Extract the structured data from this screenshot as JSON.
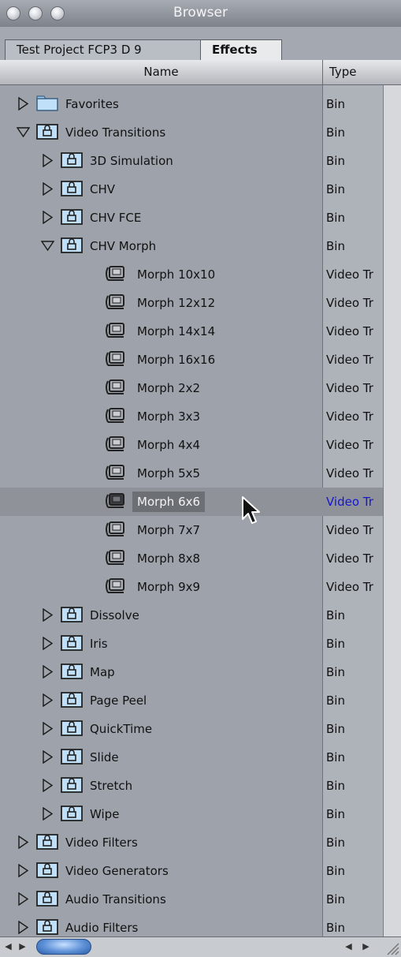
{
  "window": {
    "title": "Browser"
  },
  "tabs": [
    {
      "label": "Test Project FCP3 D 9",
      "active": false
    },
    {
      "label": "Effects",
      "active": true
    }
  ],
  "columns": {
    "name": "Name",
    "type": "Type"
  },
  "rows": [
    {
      "label": "Favorites",
      "type": "Bin",
      "level": 0,
      "expanded": false,
      "icon": "folder-icon"
    },
    {
      "label": "Video Transitions",
      "type": "Bin",
      "level": 0,
      "expanded": true,
      "icon": "locked-bin-icon"
    },
    {
      "label": "3D Simulation",
      "type": "Bin",
      "level": 1,
      "expanded": false,
      "icon": "locked-bin-icon"
    },
    {
      "label": "CHV",
      "type": "Bin",
      "level": 1,
      "expanded": false,
      "icon": "locked-bin-icon"
    },
    {
      "label": "CHV FCE",
      "type": "Bin",
      "level": 1,
      "expanded": false,
      "icon": "locked-bin-icon"
    },
    {
      "label": "CHV Morph",
      "type": "Bin",
      "level": 1,
      "expanded": true,
      "icon": "locked-bin-icon"
    },
    {
      "label": "Morph 10x10",
      "type": "Video Tr",
      "level": 2,
      "icon": "transition-icon"
    },
    {
      "label": "Morph 12x12",
      "type": "Video Tr",
      "level": 2,
      "icon": "transition-icon"
    },
    {
      "label": "Morph 14x14",
      "type": "Video Tr",
      "level": 2,
      "icon": "transition-icon"
    },
    {
      "label": "Morph 16x16",
      "type": "Video Tr",
      "level": 2,
      "icon": "transition-icon"
    },
    {
      "label": "Morph 2x2",
      "type": "Video Tr",
      "level": 2,
      "icon": "transition-icon"
    },
    {
      "label": "Morph 3x3",
      "type": "Video Tr",
      "level": 2,
      "icon": "transition-icon"
    },
    {
      "label": "Morph 4x4",
      "type": "Video Tr",
      "level": 2,
      "icon": "transition-icon"
    },
    {
      "label": "Morph 5x5",
      "type": "Video Tr",
      "level": 2,
      "icon": "transition-icon"
    },
    {
      "label": "Morph 6x6",
      "type": "Video Tr",
      "level": 2,
      "icon": "transition-icon",
      "selected": true
    },
    {
      "label": "Morph 7x7",
      "type": "Video Tr",
      "level": 2,
      "icon": "transition-icon"
    },
    {
      "label": "Morph 8x8",
      "type": "Video Tr",
      "level": 2,
      "icon": "transition-icon"
    },
    {
      "label": "Morph 9x9",
      "type": "Video Tr",
      "level": 2,
      "icon": "transition-icon"
    },
    {
      "label": "Dissolve",
      "type": "Bin",
      "level": 1,
      "expanded": false,
      "icon": "locked-bin-icon"
    },
    {
      "label": "Iris",
      "type": "Bin",
      "level": 1,
      "expanded": false,
      "icon": "locked-bin-icon"
    },
    {
      "label": "Map",
      "type": "Bin",
      "level": 1,
      "expanded": false,
      "icon": "locked-bin-icon"
    },
    {
      "label": "Page Peel",
      "type": "Bin",
      "level": 1,
      "expanded": false,
      "icon": "locked-bin-icon"
    },
    {
      "label": "QuickTime",
      "type": "Bin",
      "level": 1,
      "expanded": false,
      "icon": "locked-bin-icon"
    },
    {
      "label": "Slide",
      "type": "Bin",
      "level": 1,
      "expanded": false,
      "icon": "locked-bin-icon"
    },
    {
      "label": "Stretch",
      "type": "Bin",
      "level": 1,
      "expanded": false,
      "icon": "locked-bin-icon"
    },
    {
      "label": "Wipe",
      "type": "Bin",
      "level": 1,
      "expanded": false,
      "icon": "locked-bin-icon"
    },
    {
      "label": "Video Filters",
      "type": "Bin",
      "level": 0,
      "expanded": false,
      "icon": "locked-bin-icon"
    },
    {
      "label": "Video Generators",
      "type": "Bin",
      "level": 0,
      "expanded": false,
      "icon": "locked-bin-icon"
    },
    {
      "label": "Audio Transitions",
      "type": "Bin",
      "level": 0,
      "expanded": false,
      "icon": "locked-bin-icon"
    },
    {
      "label": "Audio Filters",
      "type": "Bin",
      "level": 0,
      "expanded": false,
      "icon": "locked-bin-icon"
    }
  ],
  "colors": {
    "selected_type_text": "#1616d0",
    "scroll_thumb": "#5c8fd6",
    "bin_icon_fill": "#bfe0f8"
  }
}
